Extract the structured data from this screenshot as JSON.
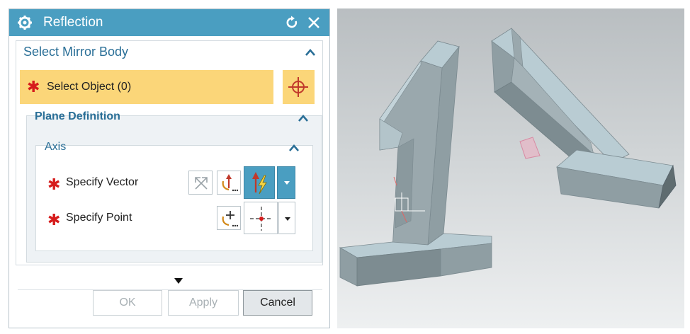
{
  "dialog": {
    "title": "Reflection",
    "icons": {
      "settings": "gear-icon",
      "reset": "reset-icon",
      "close": "close-icon"
    }
  },
  "mirror_body": {
    "title": "Select Mirror Body",
    "select_object_label": "Select Object (0)",
    "required_marker": "✱"
  },
  "plane_definition": {
    "title": "Plane Definition",
    "axis": {
      "title": "Axis",
      "specify_vector_label": "Specify Vector",
      "specify_point_label": "Specify Point",
      "required_marker": "✱"
    }
  },
  "footer": {
    "ok_label": "OK",
    "apply_label": "Apply",
    "cancel_label": "Cancel"
  },
  "colors": {
    "title_bar": "#4a9ec1",
    "section_title": "#2a6f97",
    "selection_highlight": "#fbd679",
    "required_star": "#d61c1c",
    "model_face": "#8f9ea3",
    "model_top": "#b9ccd3"
  }
}
